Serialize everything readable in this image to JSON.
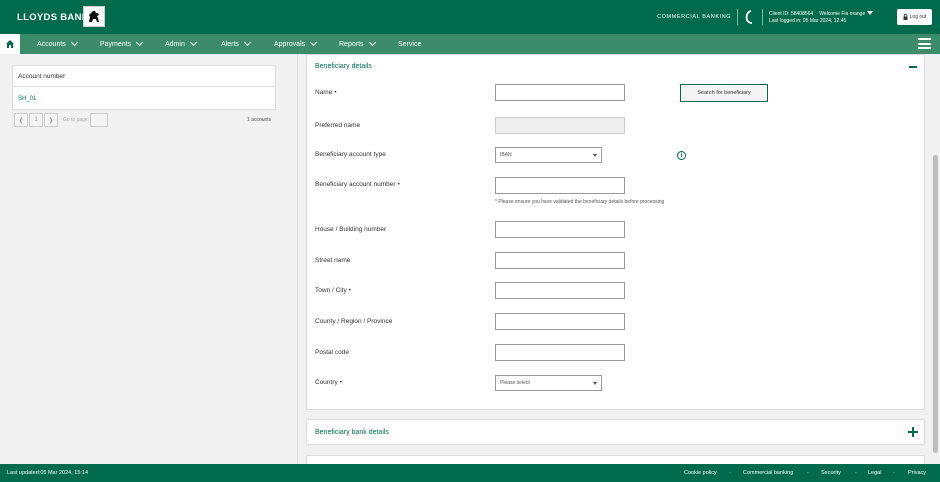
{
  "header": {
    "brand": "LLOYDS BANK",
    "section": "COMMERCIAL BANKING",
    "client_id": "Client ID: 58408564",
    "welcome": "Welcome Fia orange",
    "last_logged": "Last logged in: 05 Mar 2024, 12:45",
    "logout": "Log out"
  },
  "nav": {
    "items": [
      {
        "label": "Accounts"
      },
      {
        "label": "Payments"
      },
      {
        "label": "Admin"
      },
      {
        "label": "Alerts"
      },
      {
        "label": "Approvals"
      },
      {
        "label": "Reports"
      },
      {
        "label": "Service"
      }
    ]
  },
  "accounts": {
    "column_header": "Account number",
    "rows": [
      "SH_01"
    ],
    "page": "1",
    "goto_label": "Go to page",
    "count": "1 accounts"
  },
  "beneficiary": {
    "title": "Beneficiary details",
    "name_label": "Name",
    "search_button": "Search for beneficiary",
    "preferred_name_label": "Preferred name",
    "account_type_label": "Beneficiary account type",
    "account_type_value": "IBAN",
    "account_number_label": "Beneficiary account number",
    "note": "* Please ensure you have validated the beneficiary details before processing",
    "house_label": "House / Building number",
    "street_label": "Street name",
    "town_label": "Town / City",
    "county_label": "County / Region / Province",
    "postal_label": "Postal code",
    "country_label": "Country",
    "country_placeholder": "Please select",
    "required_mark": "•"
  },
  "bank_details": {
    "title": "Beneficiary bank details"
  },
  "footer": {
    "last_updated": "Last updated:05 Mar 2024, 15:14",
    "links": [
      "Cookie policy",
      "Commercial banking",
      "Security",
      "Legal",
      "Privacy"
    ]
  },
  "colors": {
    "brand_green": "#006a4d",
    "nav_green": "#3c8b6a"
  }
}
